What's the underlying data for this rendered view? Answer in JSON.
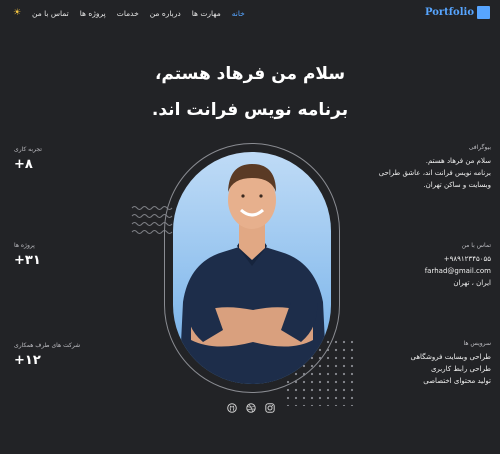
{
  "header": {
    "logo": "Portfolio",
    "nav": [
      {
        "label": "خانه",
        "active": true
      },
      {
        "label": "مهارت ها",
        "active": false
      },
      {
        "label": "درباره من",
        "active": false
      },
      {
        "label": "خدمات",
        "active": false
      },
      {
        "label": "پروژه ها",
        "active": false
      },
      {
        "label": "تماس با من",
        "active": false
      }
    ],
    "theme_icon": "sun-icon"
  },
  "hero": {
    "line1": "سلام من فرهاد هستم،",
    "line2": "برنامه نویس فرانت اند."
  },
  "stats": [
    {
      "label": "تجربه کاری",
      "value": "+۸"
    },
    {
      "label": "پروژه ها",
      "value": "+۳۱"
    },
    {
      "label": "شرکت های طرف همکاری",
      "value": "+۱۲"
    }
  ],
  "bio": {
    "label": "بیوگرافی",
    "lines": [
      "سلام من فرهاد هستم.",
      "برنامه نویس فرانت اند، عاشق طراحی",
      "وبسایت و ساکن تهران."
    ]
  },
  "contact": {
    "label": "تماس با من",
    "phone": "+۹۸۹۱۲۳۴۵۰۵۵",
    "email": "farhad@gmail.com",
    "city": "ایران ، تهران"
  },
  "services": {
    "label": "سرویس ها",
    "items": [
      "طراحی وبسایت فروشگاهی",
      "طراحی رابط کاربری",
      "تولید محتوای اختصاصی"
    ]
  },
  "social": [
    "github-icon",
    "dribbble-icon",
    "instagram-icon"
  ],
  "colors": {
    "accent": "#57a5ff",
    "background": "#222326"
  }
}
